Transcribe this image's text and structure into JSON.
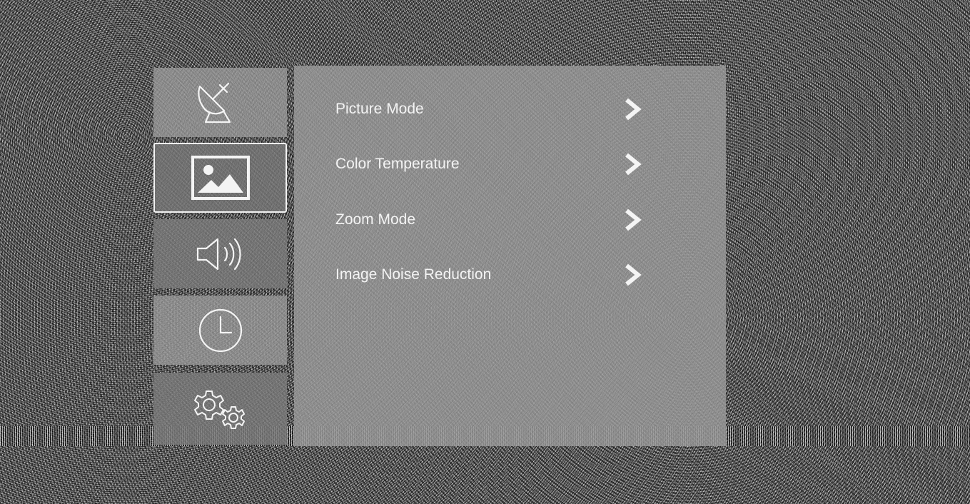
{
  "sidebar": {
    "items": [
      {
        "icon": "satellite-dish-icon",
        "active": false
      },
      {
        "icon": "picture-icon",
        "active": true
      },
      {
        "icon": "speaker-icon",
        "active": false
      },
      {
        "icon": "clock-icon",
        "active": false
      },
      {
        "icon": "gears-icon",
        "active": false
      }
    ]
  },
  "menu": {
    "items": [
      {
        "label": "Picture Mode",
        "icon": "chevron-right-icon"
      },
      {
        "label": "Color Temperature",
        "icon": "chevron-right-icon"
      },
      {
        "label": "Zoom Mode",
        "icon": "chevron-right-icon"
      },
      {
        "label": "Image Noise Reduction",
        "icon": "chevron-right-icon"
      }
    ]
  },
  "colors": {
    "text": "#f4f4f4",
    "panel": "#969696",
    "active_border": "#f2f2f2"
  }
}
